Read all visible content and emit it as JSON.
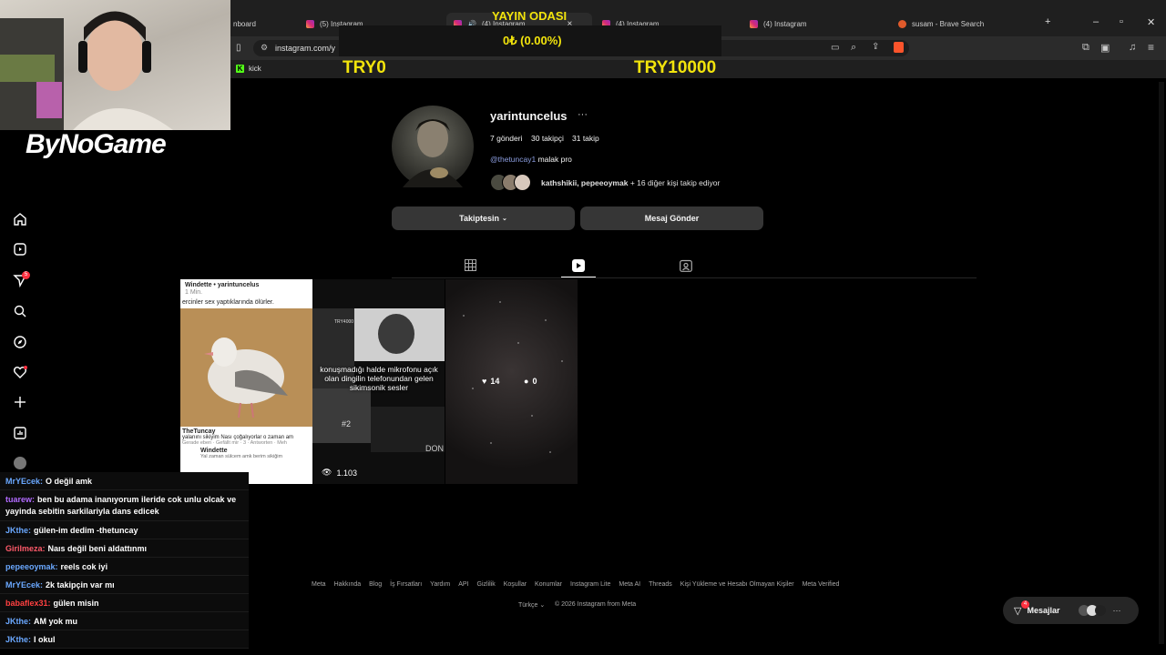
{
  "browser": {
    "tabs": [
      {
        "label": "nboard"
      },
      {
        "label": "(5) Instagram"
      },
      {
        "label": "(4) Instagram"
      },
      {
        "label": "(4) Instagram"
      },
      {
        "label": "(4) Instagram"
      },
      {
        "label": "susam - Brave Search"
      }
    ],
    "url": "instagram.com/y",
    "bookmark": "kick"
  },
  "stream_overlay": {
    "room_title": "YAYIN ODASI",
    "amount": "0₺ (0.00%)",
    "goal_start": "TRY0",
    "goal_end": "TRY10000",
    "brand": "ByNoGame"
  },
  "profile": {
    "username": "yarintuncelus",
    "posts": "7 gönderi",
    "followers": "30 takipçi",
    "following": "31 takip",
    "bio_mention": "@thetuncay1",
    "bio_text": "malak pro",
    "followed_by_names": "kathshikii, pepeeoymak",
    "followed_by_more": "+ 16 diğer kişi takip ediyor",
    "following_button": "Takiptesin",
    "message_button": "Mesaj Gönder"
  },
  "posts": [
    {
      "header": "Windette • yarintuncelus",
      "time": "1 Min.",
      "caption": "ercinler sex yaptıklarında ölürler.",
      "author": "TheTuncay",
      "reply": "yalanını sikiyim Nası çoğalıyorlar o zaman am",
      "reply_meta": "Gerade eben · Gefällt mir · 3 · Antworten · Meh",
      "author2": "Windette",
      "reply2": "Yal zaman sülcem amk berim sikiğim"
    },
    {
      "caption": "konuşmadığı halde mikrofonu açık olan dingilin telefonundan gelen sikimsonik sesler",
      "label": "TRY4000",
      "rank": "#2",
      "corner_text": "DON",
      "views": "1.103"
    },
    {
      "likes": "14",
      "comments": "0"
    }
  ],
  "chat": [
    {
      "name": "MrYEcek:",
      "msg": "O değil amk",
      "color": "#6aa8ff"
    },
    {
      "name": "tuarew:",
      "msg": "ben bu adama inanıyorum ileride cok unlu olcak ve yayinda sebitin sarkilariyla dans edicek",
      "color": "#b26bff"
    },
    {
      "name": "JKthe:",
      "msg": "gülen-im dedim -thetuncay",
      "color": "#6aa8ff"
    },
    {
      "name": "Girilmeza:",
      "msg": "Naıs değil beni aldattınmı",
      "color": "#ff5a6a"
    },
    {
      "name": "pepeeoymak:",
      "msg": "reels cok iyi",
      "color": "#6aa8ff"
    },
    {
      "name": "MrYEcek:",
      "msg": "2k takipçin var mı",
      "color": "#6aa8ff"
    },
    {
      "name": "babaflex31:",
      "msg": "gülen misin",
      "color": "#ff4040"
    },
    {
      "name": "JKthe:",
      "msg": "AM yok mu",
      "color": "#6aa8ff"
    },
    {
      "name": "JKthe:",
      "msg": "I okul",
      "color": "#6aa8ff"
    }
  ],
  "footer": {
    "links": [
      "Meta",
      "Hakkında",
      "Blog",
      "İş Fırsatları",
      "Yardım",
      "API",
      "Gizlilik",
      "Koşullar",
      "Konumlar",
      "Instagram Lite",
      "Meta AI",
      "Threads",
      "Kişi Yükleme ve Hesabı Olmayan Kişiler",
      "Meta Verified"
    ],
    "language": "Türkçe",
    "copyright": "© 2026 Instagram from Meta"
  },
  "messages_bar": {
    "label": "Mesajlar",
    "badge": "4"
  },
  "notification_badge": "5"
}
